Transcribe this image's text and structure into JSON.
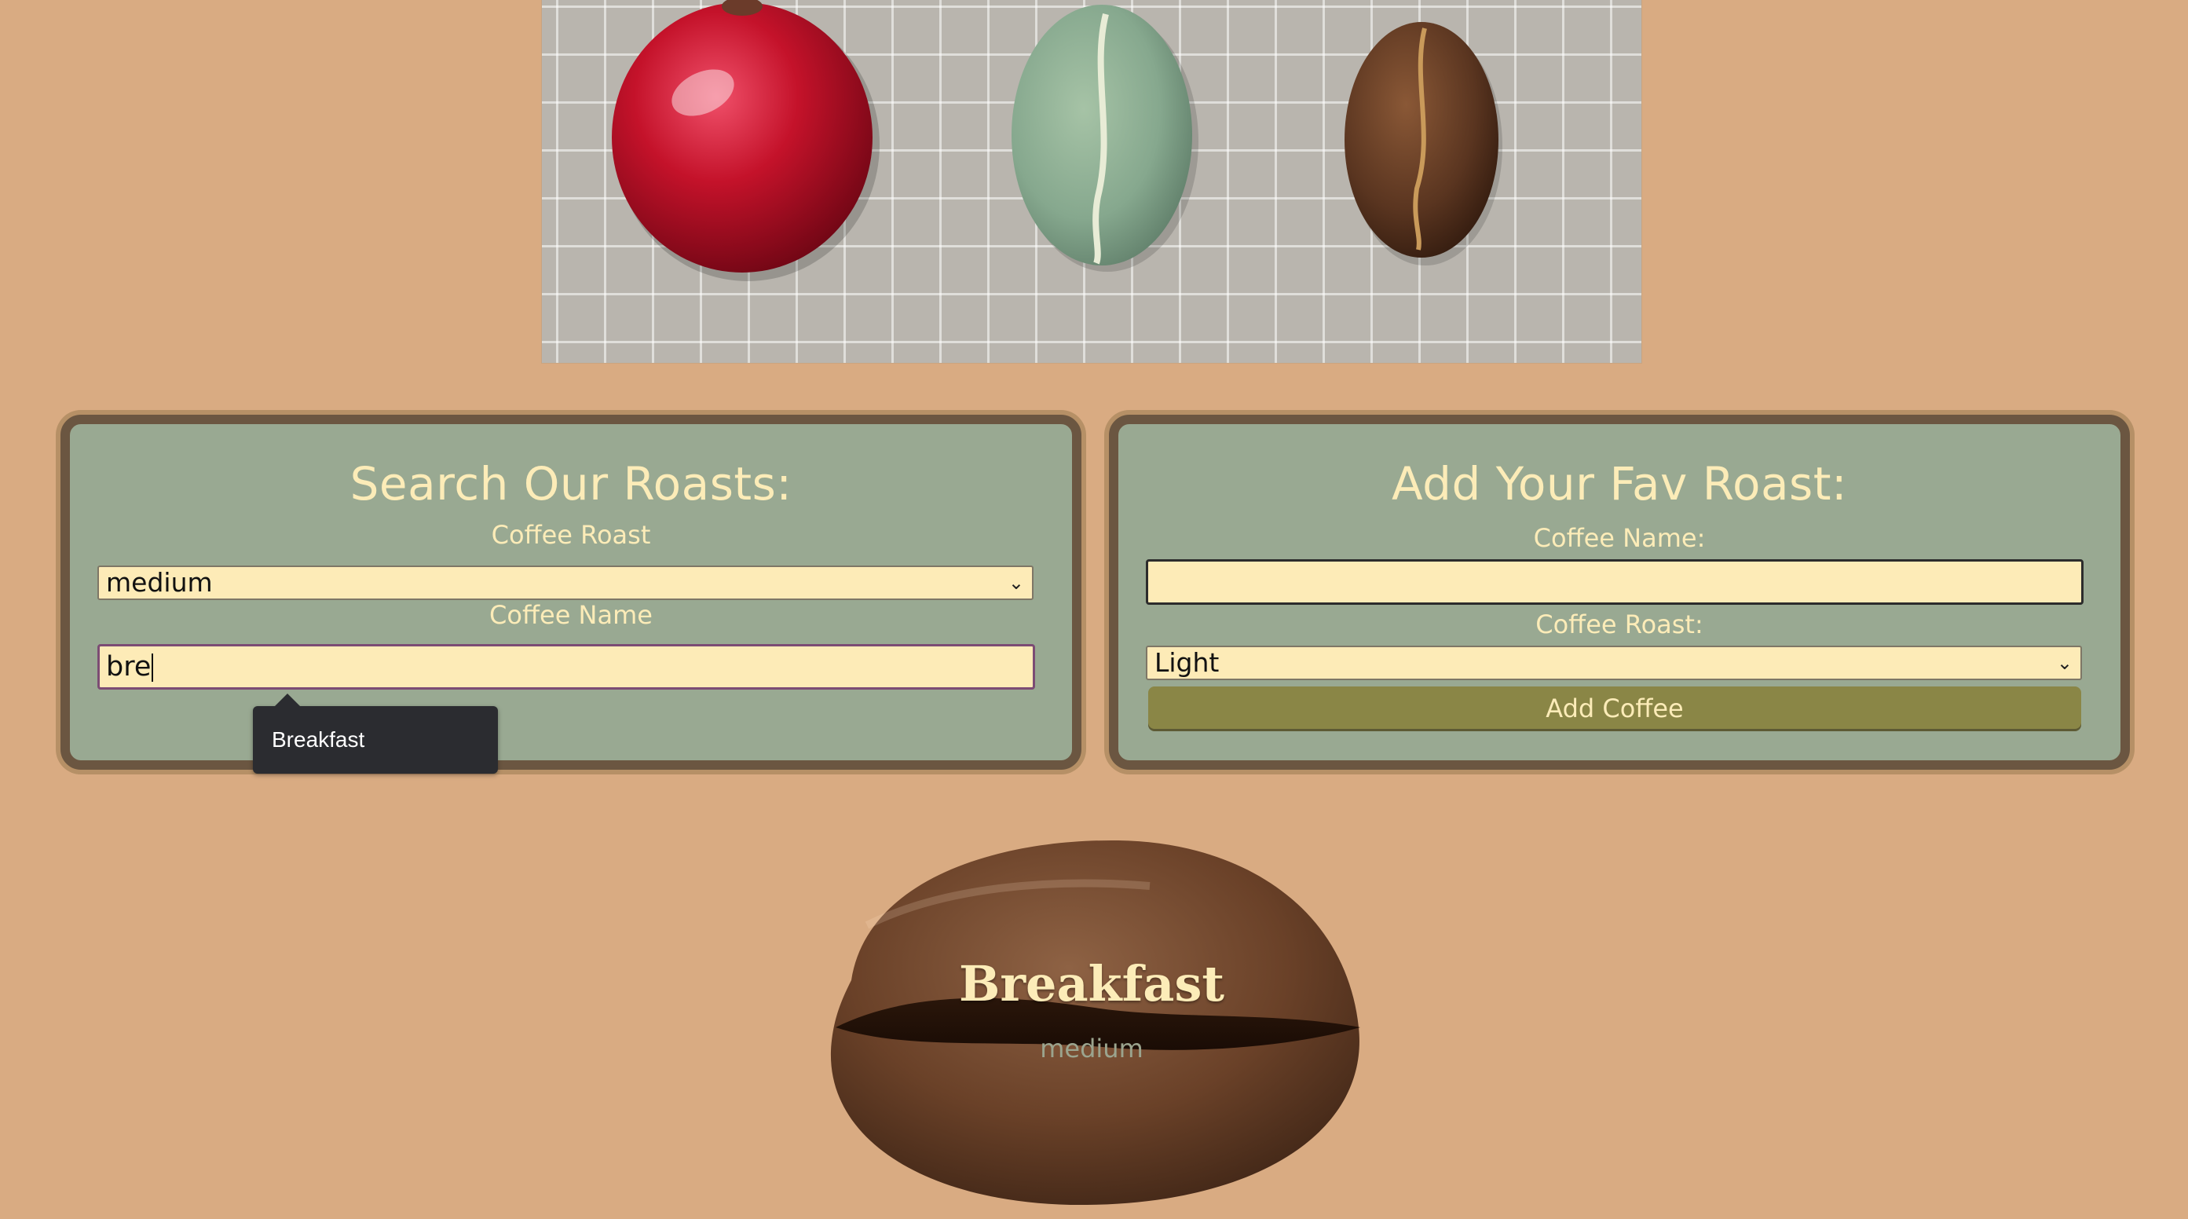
{
  "colors": {
    "background": "#d9ab82",
    "card": "#99a992",
    "card_border": "#6b5641",
    "text_cream": "#fcecb8",
    "input_bg": "#fdebb7",
    "button": "#8a8646",
    "tooltip_bg": "#2b2c30"
  },
  "hero": {
    "icons": [
      "coffee-cherry-icon",
      "green-coffee-bean-icon",
      "roasted-coffee-bean-icon"
    ]
  },
  "search": {
    "title": "Search Our Roasts:",
    "roast_label": "Coffee Roast",
    "roast_value": "medium",
    "name_label": "Coffee Name",
    "name_value": "bre",
    "suggestion": "Breakfast"
  },
  "add": {
    "title": "Add Your Fav Roast:",
    "name_label": "Coffee Name:",
    "name_value": "",
    "roast_label": "Coffee Roast:",
    "roast_value": "Light",
    "button_label": "Add Coffee"
  },
  "results": [
    {
      "name": "Breakfast",
      "roast": "medium"
    }
  ]
}
